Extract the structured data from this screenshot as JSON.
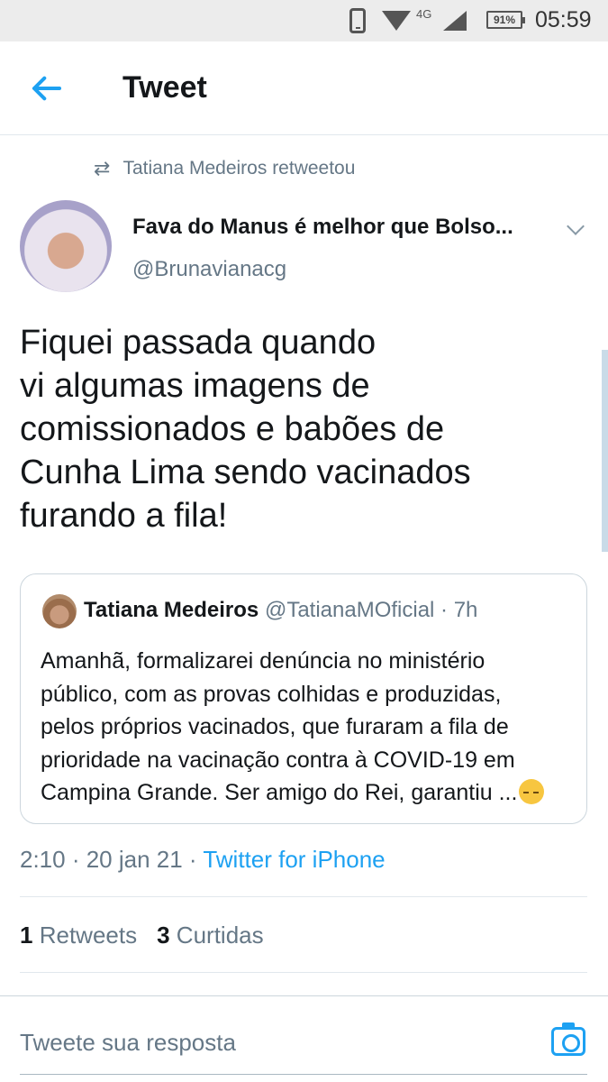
{
  "status_bar": {
    "network": "4G",
    "battery": "91%",
    "time": "05:59",
    "icons": [
      "phone-icon",
      "wifi-icon",
      "signal-icon",
      "battery-icon"
    ]
  },
  "header": {
    "title": "Tweet",
    "back_icon": "back-arrow-icon",
    "accent": "#1da1f2"
  },
  "retweet": {
    "icon": "retweet-icon",
    "text": "Tatiana Medeiros retweetou"
  },
  "tweet": {
    "author_name": "Fava do Manus é melhor que Bolso...",
    "author_handle": "@Brunavianacg",
    "lines": [
      "Fiquei passada quando",
      "vi algumas imagens de",
      "comissionados e babões de",
      "Cunha Lima sendo vacinados",
      "furando a fila!"
    ]
  },
  "quote": {
    "name": "Tatiana Medeiros",
    "meta": "@TatianaMOficial · 7h",
    "lines": [
      "Amanhã, formalizarei denúncia no ministério",
      "público, com as provas colhidas e produzidas,",
      "pelos próprios vacinados, que furaram a fila de",
      "prioridade na vacinação contra à COVID-19 em",
      "Campina Grande. Ser amigo do Rei, garantiu ..."
    ],
    "emoji": "pensive-face-emoji"
  },
  "timestamp": {
    "time_date": "2:10 · 20 jan 21 · ",
    "source": "Twitter for iPhone"
  },
  "stats": {
    "retweets_count": "1",
    "retweets_label": "Retweets",
    "likes_count": "3",
    "likes_label": "Curtidas"
  },
  "reply": {
    "placeholder": "Tweete sua resposta",
    "camera_icon": "camera-icon"
  }
}
